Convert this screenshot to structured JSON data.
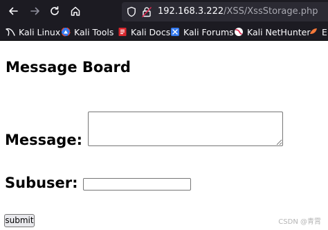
{
  "browser": {
    "nav": {
      "back_icon": "arrow-left-icon",
      "forward_icon": "arrow-right-icon",
      "reload_icon": "reload-icon",
      "home_icon": "home-icon"
    },
    "url": {
      "host": "192.168.3.222",
      "path": "/XSS/XssStorage.php"
    },
    "bookmarks": [
      {
        "label": "Kali Linux",
        "icon": "kali-dragon-icon"
      },
      {
        "label": "Kali Tools",
        "icon": "kali-tools-icon"
      },
      {
        "label": "Kali Docs",
        "icon": "kali-docs-icon"
      },
      {
        "label": "Kali Forums",
        "icon": "kali-forums-icon"
      },
      {
        "label": "Kali NetHunter",
        "icon": "kali-nethunter-icon"
      },
      {
        "label": "E",
        "icon": "exploit-db-icon"
      }
    ],
    "colors": {
      "toolbar_bg": "#1c1b22",
      "urlbar_bg": "#2b2a33"
    }
  },
  "page": {
    "title": "Message Board",
    "message_label": "Message:",
    "message_value": "",
    "subuser_label": "Subuser:",
    "subuser_value": "",
    "submit_label": "submit"
  },
  "watermark": "CSDN @青霄"
}
